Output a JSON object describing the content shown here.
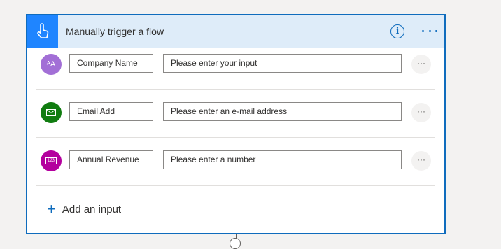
{
  "trigger": {
    "title": "Manually trigger a flow",
    "info_glyph": "i",
    "icon": "hand-touch-icon",
    "colors": {
      "accent": "#0f6cbd",
      "header_bg": "#deecf9",
      "tile": "#1f85ff"
    }
  },
  "inputs": [
    {
      "name": "Company Name",
      "placeholder": "Please enter your input",
      "icon": "text-input-icon",
      "icon_glyph": "ᴬA",
      "color": "#a26fd6"
    },
    {
      "name": "Email Add",
      "placeholder": "Please enter an e-mail address",
      "icon": "email-icon",
      "icon_glyph": "✉",
      "color": "#107c10"
    },
    {
      "name": "Annual Revenue",
      "placeholder": "Please enter a number",
      "icon": "number-icon",
      "icon_glyph": "123",
      "color": "#b4009e"
    }
  ],
  "more_glyph": "···",
  "add_input": {
    "plus": "+",
    "label": "Add an input"
  }
}
